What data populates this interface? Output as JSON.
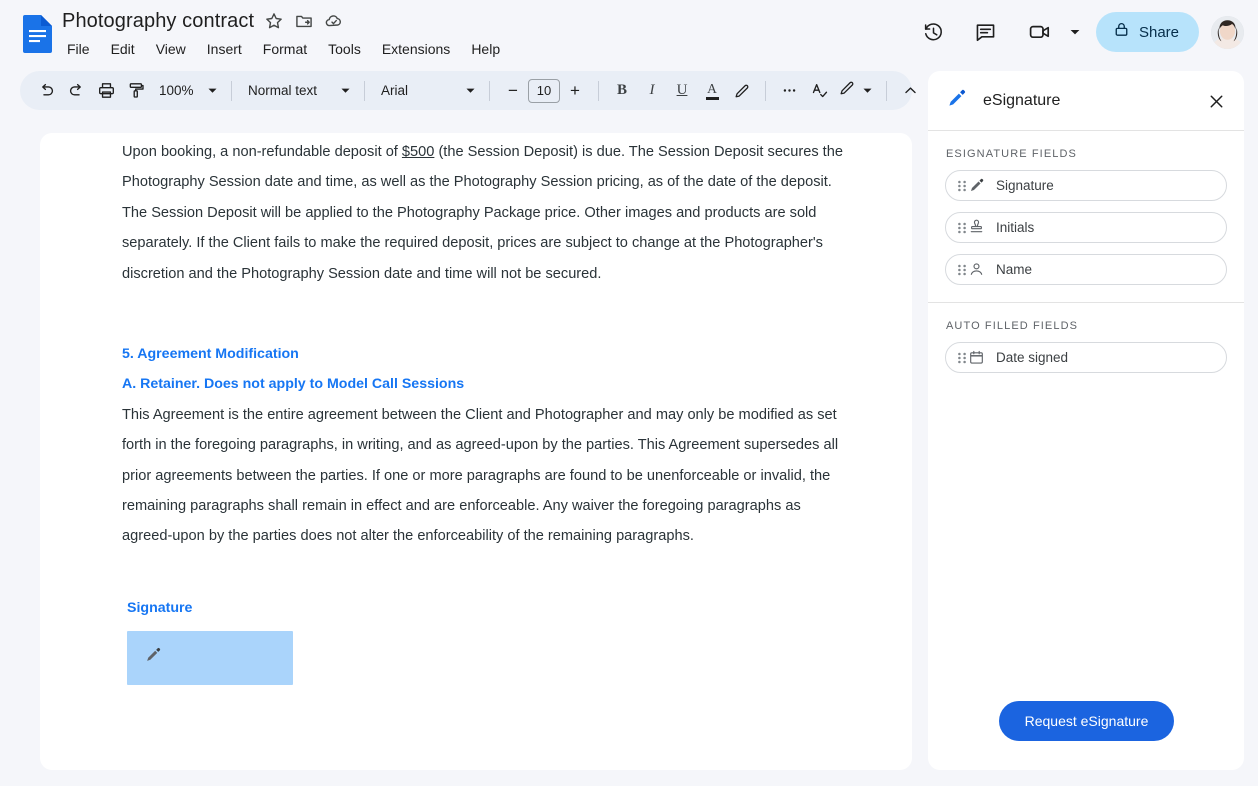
{
  "header": {
    "app_icon": "google-docs-icon",
    "doc_title": "Photography contract",
    "title_icons": [
      "star-icon",
      "move-to-folder-icon",
      "cloud-saved-icon"
    ],
    "menu": [
      "File",
      "Edit",
      "View",
      "Insert",
      "Format",
      "Tools",
      "Extensions",
      "Help"
    ],
    "right_icons": [
      "version-history-icon",
      "comment-icon",
      "meet-camera-icon",
      "chevron-down-icon"
    ],
    "share_label": "Share",
    "share_icon": "lock-icon",
    "share_bg": "#b7e3fb",
    "avatar": "user-avatar"
  },
  "toolbar": {
    "undo": "undo-icon",
    "redo": "redo-icon",
    "print": "print-icon",
    "paint_format": "paint-format-icon",
    "zoom_value": "100%",
    "style_value": "Normal text",
    "font_value": "Arial",
    "font_size_decrease": "−",
    "font_size_value": "10",
    "font_size_increase": "+",
    "bold": "B",
    "italic": "I",
    "underline": "U",
    "text_color": "A",
    "highlight": "highlight-pen-icon",
    "more": "more-options-icon",
    "spelling": "spellcheck-icon",
    "editing_mode": "editing-pencil-icon",
    "collapse": "collapse-toolbar-icon"
  },
  "document": {
    "paragraph1_pre": "Upon booking, a non-refundable deposit of ",
    "paragraph1_underlined": "$500",
    "paragraph1_post": " (the Session Deposit) is due. The Session Deposit secures the Photography Session date and time, as well as the Photography Session pricing, as of the date of the deposit. The Session Deposit will be applied to the Photography Package price. Other images and products are sold separately. If the Client fails to make the required deposit, prices are subject to change at the Photographer's discretion and the Photography Session date and time will not be secured.",
    "heading_section": "5. Agreement Modification",
    "heading_sub": "A. Retainer.  Does not apply to Model Call Sessions",
    "paragraph2": "This Agreement is the entire agreement between the Client and Photographer and may only be modified as set forth in the foregoing paragraphs, in writing, and as agreed-upon by the parties.  This Agreement supersedes all prior agreements between the parties. If one or more paragraphs are found to be unenforceable or invalid, the remaining paragraphs shall remain in effect and are enforceable. Any waiver the foregoing paragraphs as agreed-upon by the parties does not alter the enforceability of the remaining paragraphs.",
    "signature_label": "Signature",
    "signature_placeholder_icon": "signature-pen-icon",
    "signature_placeholder_color": "#aad4fb",
    "heading_color": "#1676f3"
  },
  "panel": {
    "icon": "esignature-pen-icon",
    "title": "eSignature",
    "close_icon": "close-icon",
    "sections": [
      {
        "title": "ESIGNATURE FIELDS",
        "fields": [
          {
            "label": "Signature",
            "icon": "signature-pen-icon",
            "grip": "drag-handle-icon"
          },
          {
            "label": "Initials",
            "icon": "stamp-icon",
            "grip": "drag-handle-icon"
          },
          {
            "label": "Name",
            "icon": "person-icon",
            "grip": "drag-handle-icon"
          }
        ]
      },
      {
        "title": "AUTO FILLED FIELDS",
        "fields": [
          {
            "label": "Date signed",
            "icon": "calendar-icon",
            "grip": "drag-handle-icon"
          }
        ]
      }
    ],
    "request_button_label": "Request eSignature",
    "request_button_color": "#1b64e0"
  }
}
